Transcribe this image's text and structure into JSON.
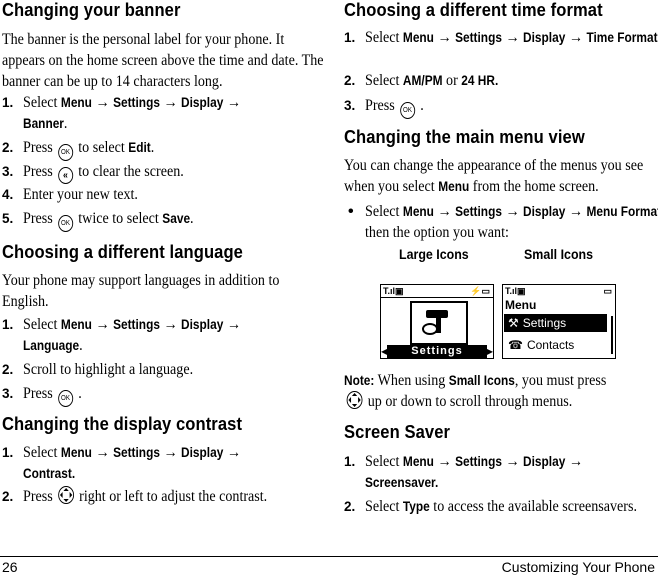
{
  "left": {
    "banner": {
      "heading": "Changing your banner",
      "intro": "The banner is the personal label for your phone. It appears on the home screen above the time and date. The banner can be up to 14 characters long.",
      "steps": [
        {
          "num": "1.",
          "pre": "Select ",
          "path": [
            "Menu",
            "Settings",
            "Display",
            "Banner"
          ],
          "post": "."
        },
        {
          "num": "2.",
          "pre": "Press",
          "icon": "ok-key-icon",
          "mid": "to select ",
          "bold": "Edit",
          "post": "."
        },
        {
          "num": "3.",
          "pre": "Press",
          "icon": "back-key-icon",
          "mid": "to clear the screen."
        },
        {
          "num": "4.",
          "text": "Enter your new text."
        },
        {
          "num": "5.",
          "pre": "Press",
          "icon": "ok-key-icon",
          "mid": "twice to select ",
          "bold": "Save",
          "post": "."
        }
      ]
    },
    "language": {
      "heading": "Choosing a different language",
      "intro": "Your phone may support languages in addition to English.",
      "steps": [
        {
          "num": "1.",
          "pre": "Select ",
          "path": [
            "Menu",
            "Settings",
            "Display",
            "Language"
          ],
          "post": "."
        },
        {
          "num": "2.",
          "text": "Scroll to highlight a language."
        },
        {
          "num": "3.",
          "pre": "Press",
          "icon": "ok-key-icon",
          "post": "."
        }
      ]
    },
    "contrast": {
      "heading": "Changing the display contrast",
      "steps": [
        {
          "num": "1.",
          "pre": "Select ",
          "path": [
            "Menu",
            "Settings",
            "Display",
            "Contrast."
          ]
        },
        {
          "num": "2.",
          "pre": "Press",
          "icon": "nav-key-icon",
          "mid": "right or left to adjust the contrast."
        }
      ]
    }
  },
  "right": {
    "time": {
      "heading": "Choosing a different time format",
      "steps": [
        {
          "num": "1.",
          "pre": "Select ",
          "path": [
            "Menu",
            "Settings",
            "Display",
            "Time Format."
          ]
        },
        {
          "num": "2.",
          "pre": "Select ",
          "bold1": "AM/PM",
          "mid": " or ",
          "bold2": "24 HR."
        },
        {
          "num": "3.",
          "pre": "Press",
          "icon": "ok-key-icon",
          "post": "."
        }
      ]
    },
    "menu_view": {
      "heading": "Changing the main menu view",
      "intro_pre": "You can change the appearance of the menus you see when you select ",
      "intro_bold": "Menu",
      "intro_post": " from the home screen.",
      "bullet": {
        "pre": "Select ",
        "path": [
          "Menu",
          "Settings",
          "Display",
          "Menu Format"
        ],
        "post": ", then the option you want:"
      },
      "options": [
        "Large Icons",
        "Small Icons"
      ],
      "large_screen": {
        "label": "Settings"
      },
      "small_screen": {
        "title": "Menu",
        "items": [
          "Settings",
          "Contacts"
        ]
      }
    },
    "note": {
      "label": "Note:",
      "pre": " When using ",
      "bold": "Small Icons",
      "post": ", you must press",
      "line2": "up or down to scroll through menus."
    },
    "screensaver": {
      "heading": "Screen Saver",
      "steps": [
        {
          "num": "1.",
          "pre": "Select ",
          "path": [
            "Menu",
            "Settings",
            "Display",
            "Screensaver."
          ]
        },
        {
          "num": "2.",
          "pre": "Select ",
          "bold": "Type",
          "post": " to access the available screensavers."
        }
      ]
    }
  },
  "footer": {
    "page_number": "26",
    "chapter": "Customizing Your Phone"
  },
  "arrow": "→",
  "ok_label": "OK"
}
